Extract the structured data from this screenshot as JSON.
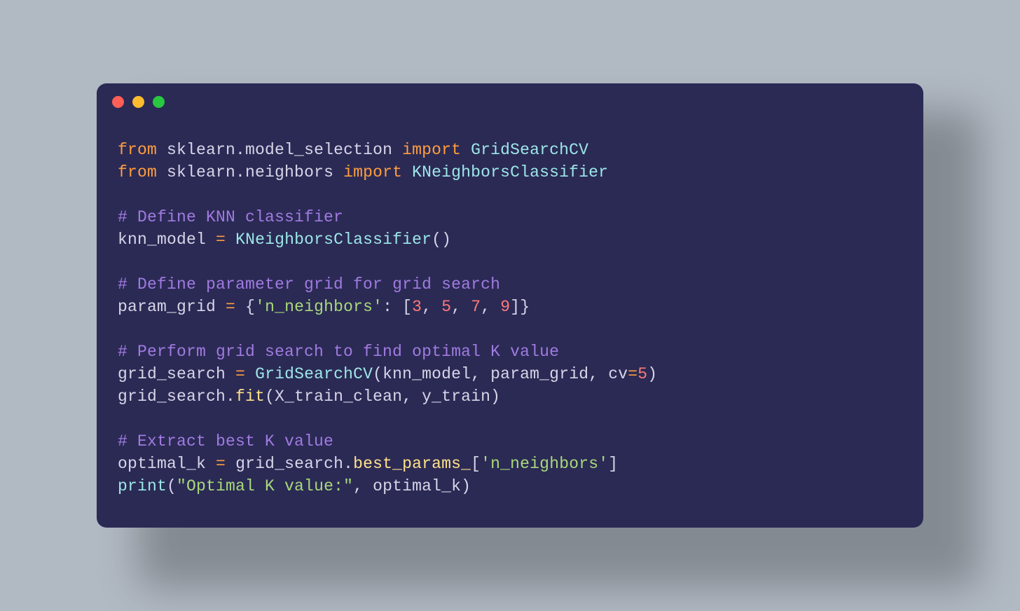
{
  "code": {
    "l1": {
      "from": "from",
      "mod": "sklearn.model_selection",
      "import": "import",
      "cls": "GridSearchCV"
    },
    "l2": {
      "from": "from",
      "mod": "sklearn.neighbors",
      "import": "import",
      "cls": "KNeighborsClassifier"
    },
    "c1": "# Define KNN classifier",
    "l4": {
      "lhs": "knn_model",
      "eq": "=",
      "call": "KNeighborsClassifier",
      "parens": "()"
    },
    "c2": "# Define parameter grid for grid search",
    "l6": {
      "lhs": "param_grid",
      "eq": "=",
      "open": "{",
      "key": "'n_neighbors'",
      "colon": ":",
      "lbrack": "[",
      "n1": "3",
      "n2": "5",
      "n3": "7",
      "n4": "9",
      "rbrack": "]",
      "close": "}",
      "comma": ", "
    },
    "c3": "# Perform grid search to find optimal K value",
    "l8": {
      "lhs": "grid_search",
      "eq": "=",
      "call": "GridSearchCV",
      "open": "(",
      "a1": "knn_model",
      "c": ", ",
      "a2": "param_grid",
      "a3k": "cv",
      "a3eq": "=",
      "a3v": "5",
      "close": ")"
    },
    "l9": {
      "obj": "grid_search",
      "dot": ".",
      "method": "fit",
      "open": "(",
      "a1": "X_train_clean",
      "c": ", ",
      "a2": "y_train",
      "close": ")"
    },
    "c4": "# Extract best K value",
    "l11": {
      "lhs": "optimal_k",
      "eq": "=",
      "obj": "grid_search",
      "dot": ".",
      "attr": "best_params_",
      "lb": "[",
      "key": "'n_neighbors'",
      "rb": "]"
    },
    "l12": {
      "fn": "print",
      "open": "(",
      "s": "\"Optimal K value:\"",
      "c": ", ",
      "arg": "optimal_k",
      "close": ")"
    }
  }
}
